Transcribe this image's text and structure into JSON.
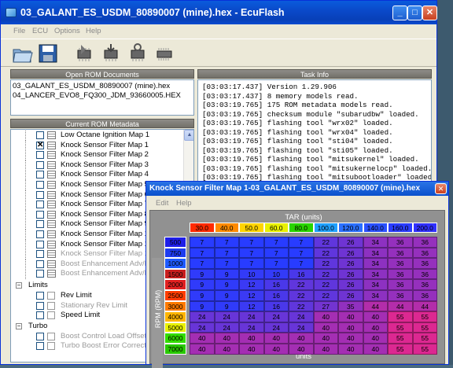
{
  "window": {
    "title": "03_GALANT_ES_USDM_80890007 (mine).hex - EcuFlash",
    "controls": [
      "_",
      "□",
      "✕"
    ]
  },
  "menu": [
    "File",
    "ECU",
    "Options",
    "Help"
  ],
  "toolbar": {
    "icons": [
      "open-folder-icon",
      "save-disk-icon",
      "read-chip-icon",
      "write-chip-icon",
      "test-chip-icon",
      "memory-chip-icon"
    ]
  },
  "open_rom": {
    "header": "Open ROM Documents",
    "items": [
      "03_GALANT_ES_USDM_80890007 (mine).hex",
      "04_LANCER_EVO8_FQ300_JDM_93660005.HEX"
    ]
  },
  "metadata": {
    "header": "Current ROM Metadata",
    "items": [
      {
        "label": "Low Octane Ignition Map 1",
        "checked": false,
        "grey": false
      },
      {
        "label": "Knock Sensor Filter Map 1",
        "checked": true,
        "grey": false
      },
      {
        "label": "Knock Sensor Filter Map 2",
        "checked": false,
        "grey": false
      },
      {
        "label": "Knock Sensor Filter Map 3",
        "checked": false,
        "grey": false
      },
      {
        "label": "Knock Sensor Filter Map 4",
        "checked": false,
        "grey": false
      },
      {
        "label": "Knock Sensor Filter Map 5",
        "checked": false,
        "grey": false
      },
      {
        "label": "Knock Sensor Filter Map 6",
        "checked": false,
        "grey": false
      },
      {
        "label": "Knock Sensor Filter Map 7",
        "checked": false,
        "grey": false
      },
      {
        "label": "Knock Sensor Filter Map 8",
        "checked": false,
        "grey": false
      },
      {
        "label": "Knock Sensor Filter Map 9",
        "checked": false,
        "grey": false
      },
      {
        "label": "Knock Sensor Filter Map 10",
        "checked": false,
        "grey": false
      },
      {
        "label": "Knock Sensor Filter Map 11",
        "checked": false,
        "grey": false
      },
      {
        "label": "Knock Sensor Filter Map 12",
        "checked": false,
        "grey": true
      },
      {
        "label": "Boost Enhancement Adv/Ret",
        "checked": false,
        "grey": true
      },
      {
        "label": "Boost Enhancement Adv/Ret",
        "checked": false,
        "grey": true
      }
    ],
    "groups": [
      {
        "name": "Limits",
        "items": [
          {
            "label": "Rev Limit",
            "grey": false
          },
          {
            "label": "Stationary Rev Limit",
            "grey": true
          },
          {
            "label": "Speed Limit",
            "grey": false
          }
        ]
      },
      {
        "name": "Turbo",
        "items": [
          {
            "label": "Boost Control Load Offset",
            "grey": true
          },
          {
            "label": "Turbo Boost Error Correction",
            "grey": true
          }
        ]
      }
    ]
  },
  "task": {
    "header": "Task Info",
    "lines": [
      "[03:03:17.437] Version 1.29.906",
      "[03:03:17.437] 8 memory models read.",
      "[03:03:19.765] 175 ROM metadata models read.",
      "[03:03:19.765] checksum module \"subarudbw\" loaded.",
      "[03:03:19.765] flashing tool \"wrx02\" loaded.",
      "[03:03:19.765] flashing tool \"wrx04\" loaded.",
      "[03:03:19.765] flashing tool \"sti04\" loaded.",
      "[03:03:19.765] flashing tool \"sti05\" loaded.",
      "[03:03:19.765] flashing tool \"mitsukernel\" loaded.",
      "[03:03:19.765] flashing tool \"mitsukernelocp\" loaded.",
      "[03:03:19.765] flashing tool \"mitsubootloader\" loaded."
    ]
  },
  "map": {
    "title": "Knock Sensor Filter Map 1-03_GALANT_ES_USDM_80890007 (mine).hex",
    "menu": [
      "Edit",
      "Help"
    ],
    "x_label": "TAR (units)",
    "y_label": "RPM (RPM)",
    "footer": "units",
    "x_axis": [
      "30.0",
      "40.0",
      "50.0",
      "60.0",
      "80.0",
      "100.0",
      "120.0",
      "140.0",
      "160.0",
      "200.0"
    ],
    "y_axis": [
      "500",
      "750",
      "1000",
      "1500",
      "2000",
      "2500",
      "3000",
      "4000",
      "5000",
      "6000",
      "7000"
    ],
    "x_colors": [
      "#ff2a00",
      "#ff8a00",
      "#ffd400",
      "#e8f000",
      "#28d400",
      "#1fa0ff",
      "#2a6fff",
      "#2a50ff",
      "#2a3cff",
      "#3030ff"
    ],
    "y_colors": [
      "#1e1ee8",
      "#1e3cf0",
      "#1e5aff",
      "#c81e1e",
      "#e02020",
      "#ff3c00",
      "#ff7a00",
      "#ffb400",
      "#e8f000",
      "#32dc00",
      "#28c800"
    ],
    "values": [
      [
        7,
        7,
        7,
        7,
        7,
        22,
        26,
        34,
        36,
        36
      ],
      [
        7,
        7,
        7,
        7,
        7,
        22,
        26,
        34,
        36,
        36
      ],
      [
        7,
        7,
        7,
        7,
        7,
        22,
        26,
        34,
        36,
        36
      ],
      [
        9,
        9,
        10,
        10,
        16,
        22,
        26,
        34,
        36,
        36
      ],
      [
        9,
        9,
        12,
        16,
        22,
        22,
        26,
        34,
        36,
        36
      ],
      [
        9,
        9,
        12,
        16,
        22,
        22,
        26,
        34,
        36,
        36
      ],
      [
        9,
        9,
        12,
        16,
        22,
        27,
        35,
        44,
        44,
        44
      ],
      [
        24,
        24,
        24,
        24,
        24,
        40,
        40,
        40,
        55,
        55
      ],
      [
        24,
        24,
        24,
        24,
        24,
        40,
        40,
        40,
        55,
        55
      ],
      [
        40,
        40,
        40,
        40,
        40,
        40,
        40,
        40,
        55,
        55
      ],
      [
        40,
        40,
        40,
        40,
        40,
        40,
        40,
        40,
        55,
        55
      ]
    ]
  }
}
